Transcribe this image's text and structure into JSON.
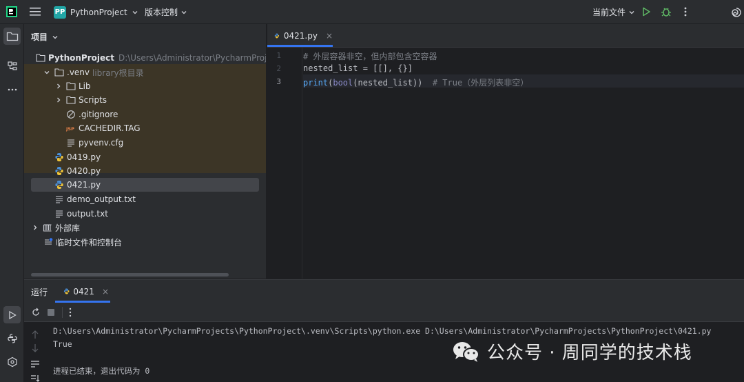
{
  "titlebar": {
    "project_badge": "PP",
    "project_name": "PythonProject",
    "vcs_label": "版本控制",
    "current_file_label": "当前文件"
  },
  "project_panel": {
    "header": "项目",
    "root_name": "PythonProject",
    "root_path": "D:\\Users\\Administrator\\PycharmProjects\\Pyth",
    "venv_name": ".venv",
    "venv_hint": "library根目录",
    "items": [
      {
        "label": "Lib"
      },
      {
        "label": "Scripts"
      },
      {
        "label": ".gitignore"
      },
      {
        "label": "CACHEDIR.TAG"
      },
      {
        "label": "pyvenv.cfg"
      },
      {
        "label": "0419.py"
      },
      {
        "label": "0420.py"
      },
      {
        "label": "0421.py"
      },
      {
        "label": "demo_output.txt"
      },
      {
        "label": "output.txt"
      },
      {
        "label": "外部库"
      },
      {
        "label": "临时文件和控制台"
      }
    ]
  },
  "editor": {
    "tab_label": "0421.py",
    "tab_close": "×",
    "line_numbers": [
      "1",
      "2",
      "3"
    ],
    "line1": "# 外层容器非空，但内部包含空容器",
    "line2": "nested_list = [[], {}]",
    "line3_fn": "print",
    "line3_p1": "(",
    "line3_bi": "bool",
    "line3_rest": "(nested_list))  ",
    "line3_cmt": "# True（外层列表非空）"
  },
  "run_panel": {
    "title": "运行",
    "tab_label": "0421",
    "tab_close": "×",
    "console": [
      "D:\\Users\\Administrator\\PycharmProjects\\PythonProject\\.venv\\Scripts\\python.exe D:\\Users\\Administrator\\PycharmProjects\\PythonProject\\0421.py",
      "True",
      "",
      "进程已结束，退出代码为 0"
    ]
  },
  "watermark": {
    "text": "公众号 · 周同学的技术栈"
  },
  "colors": {
    "accent": "#3574f0",
    "run_green": "#5fb865",
    "teal_badge": "#21a6a6"
  }
}
